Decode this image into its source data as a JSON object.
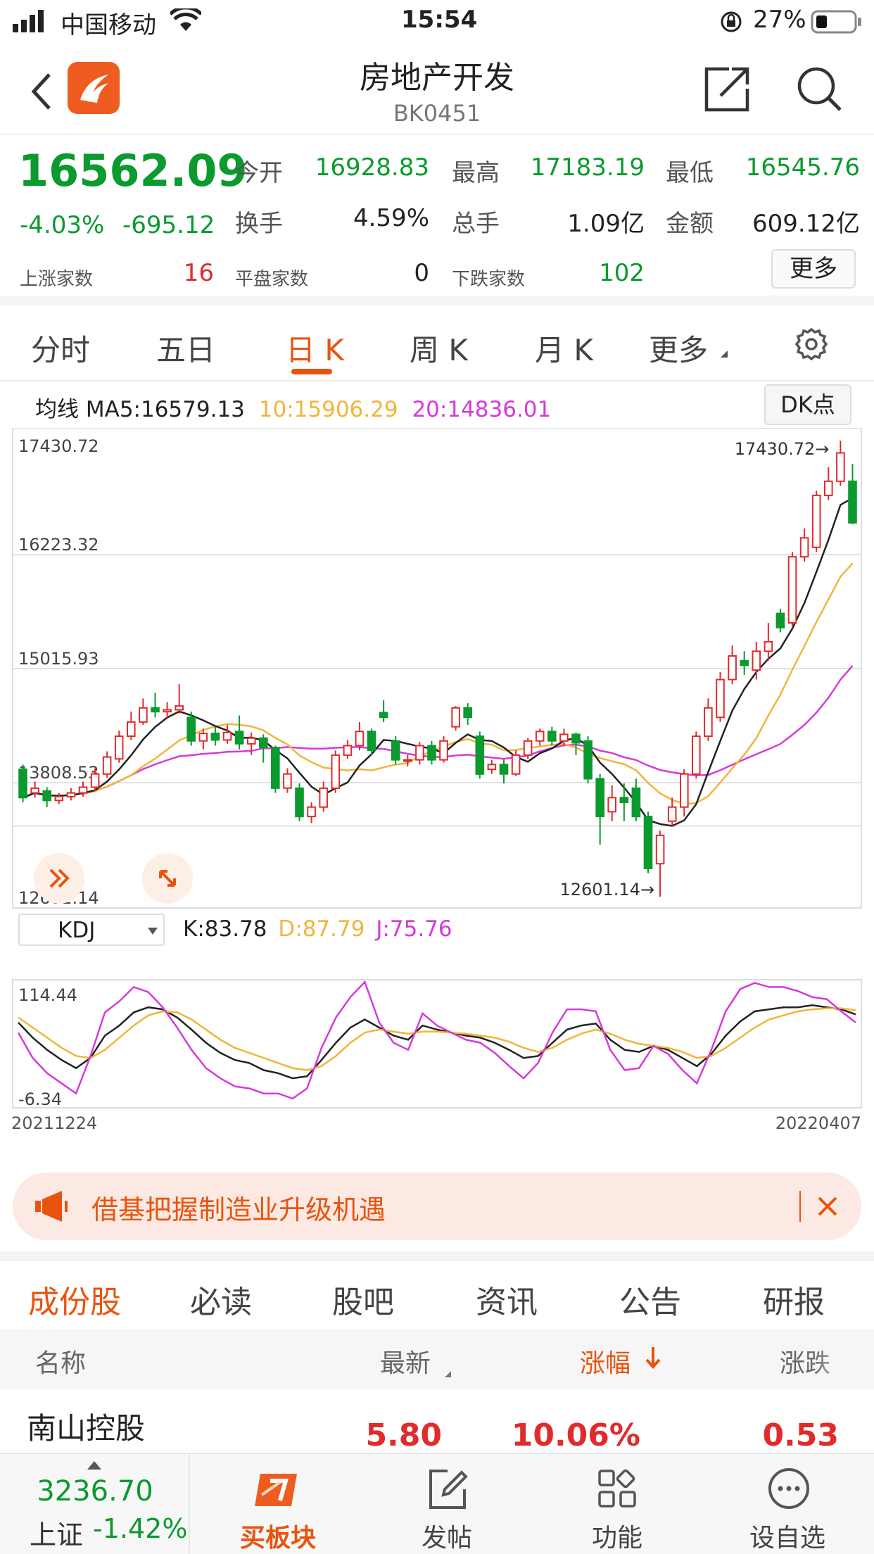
{
  "status": {
    "carrier": "中国移动",
    "time": "15:54",
    "battery": "27%"
  },
  "nav": {
    "title": "房地产开发",
    "code": "BK0451"
  },
  "quote": {
    "price": "16562.09",
    "change_pct": "-4.03%",
    "change": "-695.12",
    "open_label": "今开",
    "open": "16928.83",
    "high_label": "最高",
    "high": "17183.19",
    "low_label": "最低",
    "low": "16545.76",
    "turnover_label": "换手",
    "turnover": "4.59%",
    "volume_label": "总手",
    "volume": "1.09亿",
    "amount_label": "金额",
    "amount": "609.12亿",
    "up_label": "上涨家数",
    "up": "16",
    "flat_label": "平盘家数",
    "flat": "0",
    "down_label": "下跌家数",
    "down": "102",
    "more": "更多"
  },
  "tabs": [
    "分时",
    "五日",
    "日 K",
    "周 K",
    "月 K",
    "更多"
  ],
  "active_tab": "日 K",
  "ma": {
    "label": "均线",
    "ma5": "MA5:16579.13",
    "ma10": "10:15906.29",
    "ma20": "20:14836.01",
    "dk": "DK点"
  },
  "kdj": {
    "label": "KDJ",
    "k": "K:83.78",
    "d": "D:87.79",
    "j": "J:75.76"
  },
  "colors": {
    "up": "#e02b2b",
    "down": "#0a9a2e",
    "ma10": "#f2b53a",
    "ma20": "#d63ad8",
    "accent": "#e8540f"
  },
  "chart_data": [
    {
      "type": "candlestick",
      "ylim": [
        12601.14,
        17430.72
      ],
      "y_ticks": [
        "17430.72",
        "16223.32",
        "15015.93",
        "13808.53",
        "12601.14"
      ],
      "x_range": [
        "20211224",
        "20220407"
      ],
      "annotations": {
        "max": "17430.72",
        "min": "12601.14"
      },
      "candles": [
        {
          "o": 13950,
          "c": 13650,
          "h": 14000,
          "l": 13600
        },
        {
          "o": 13700,
          "c": 13750,
          "h": 13820,
          "l": 13650
        },
        {
          "o": 13720,
          "c": 13620,
          "h": 13760,
          "l": 13550
        },
        {
          "o": 13620,
          "c": 13660,
          "h": 13700,
          "l": 13580
        },
        {
          "o": 13660,
          "c": 13700,
          "h": 13750,
          "l": 13620
        },
        {
          "o": 13700,
          "c": 13760,
          "h": 13820,
          "l": 13660
        },
        {
          "o": 13760,
          "c": 13900,
          "h": 13960,
          "l": 13720
        },
        {
          "o": 13900,
          "c": 14080,
          "h": 14140,
          "l": 13860
        },
        {
          "o": 14060,
          "c": 14300,
          "h": 14360,
          "l": 14020
        },
        {
          "o": 14300,
          "c": 14450,
          "h": 14560,
          "l": 14260
        },
        {
          "o": 14450,
          "c": 14600,
          "h": 14700,
          "l": 14420
        },
        {
          "o": 14600,
          "c": 14560,
          "h": 14760,
          "l": 14500
        },
        {
          "o": 14560,
          "c": 14580,
          "h": 14660,
          "l": 14480
        },
        {
          "o": 14580,
          "c": 14620,
          "h": 14850,
          "l": 14540
        },
        {
          "o": 14500,
          "c": 14250,
          "h": 14560,
          "l": 14200
        },
        {
          "o": 14250,
          "c": 14330,
          "h": 14380,
          "l": 14160
        },
        {
          "o": 14330,
          "c": 14260,
          "h": 14400,
          "l": 14200
        },
        {
          "o": 14260,
          "c": 14340,
          "h": 14420,
          "l": 14220
        },
        {
          "o": 14350,
          "c": 14220,
          "h": 14520,
          "l": 14160
        },
        {
          "o": 14220,
          "c": 14280,
          "h": 14340,
          "l": 14100
        },
        {
          "o": 14280,
          "c": 14180,
          "h": 14320,
          "l": 14020
        },
        {
          "o": 14180,
          "c": 13750,
          "h": 14200,
          "l": 13700
        },
        {
          "o": 13750,
          "c": 13900,
          "h": 13960,
          "l": 13700
        },
        {
          "o": 13750,
          "c": 13450,
          "h": 13800,
          "l": 13400
        },
        {
          "o": 13450,
          "c": 13550,
          "h": 13600,
          "l": 13380
        },
        {
          "o": 13550,
          "c": 13750,
          "h": 13820,
          "l": 13500
        },
        {
          "o": 13750,
          "c": 14100,
          "h": 14150,
          "l": 13700
        },
        {
          "o": 14100,
          "c": 14200,
          "h": 14260,
          "l": 14060
        },
        {
          "o": 14200,
          "c": 14350,
          "h": 14450,
          "l": 14150
        },
        {
          "o": 14350,
          "c": 14150,
          "h": 14380,
          "l": 14100
        },
        {
          "o": 14550,
          "c": 14500,
          "h": 14680,
          "l": 14450
        },
        {
          "o": 14250,
          "c": 14050,
          "h": 14300,
          "l": 14000
        },
        {
          "o": 14050,
          "c": 14050,
          "h": 14100,
          "l": 13980
        },
        {
          "o": 14050,
          "c": 14200,
          "h": 14240,
          "l": 14000
        },
        {
          "o": 14200,
          "c": 14050,
          "h": 14250,
          "l": 14000
        },
        {
          "o": 14050,
          "c": 14250,
          "h": 14300,
          "l": 14020
        },
        {
          "o": 14400,
          "c": 14600,
          "h": 14620,
          "l": 14360
        },
        {
          "o": 14600,
          "c": 14500,
          "h": 14650,
          "l": 14420
        },
        {
          "o": 14300,
          "c": 13900,
          "h": 14350,
          "l": 13850
        },
        {
          "o": 13950,
          "c": 14000,
          "h": 14050,
          "l": 13900
        },
        {
          "o": 14000,
          "c": 13900,
          "h": 14050,
          "l": 13800
        },
        {
          "o": 13900,
          "c": 14100,
          "h": 14150,
          "l": 13880
        },
        {
          "o": 14100,
          "c": 14250,
          "h": 14280,
          "l": 14060
        },
        {
          "o": 14250,
          "c": 14350,
          "h": 14380,
          "l": 14200
        },
        {
          "o": 14350,
          "c": 14250,
          "h": 14400,
          "l": 14200
        },
        {
          "o": 14250,
          "c": 14320,
          "h": 14380,
          "l": 14200
        },
        {
          "o": 14320,
          "c": 14230,
          "h": 14340,
          "l": 14100
        },
        {
          "o": 14250,
          "c": 13850,
          "h": 14300,
          "l": 13800
        },
        {
          "o": 13850,
          "c": 13450,
          "h": 13900,
          "l": 13150
        },
        {
          "o": 13500,
          "c": 13650,
          "h": 13780,
          "l": 13400
        },
        {
          "o": 13650,
          "c": 13600,
          "h": 13800,
          "l": 13400
        },
        {
          "o": 13750,
          "c": 13450,
          "h": 13850,
          "l": 13400
        },
        {
          "o": 13450,
          "c": 12900,
          "h": 13500,
          "l": 12850
        },
        {
          "o": 12950,
          "c": 13250,
          "h": 13300,
          "l": 12601
        },
        {
          "o": 13400,
          "c": 13550,
          "h": 13650,
          "l": 13350
        },
        {
          "o": 13550,
          "c": 13900,
          "h": 13950,
          "l": 13450
        },
        {
          "o": 13900,
          "c": 14300,
          "h": 14350,
          "l": 13850
        },
        {
          "o": 14300,
          "c": 14600,
          "h": 14700,
          "l": 14250
        },
        {
          "o": 14500,
          "c": 14900,
          "h": 14980,
          "l": 14450
        },
        {
          "o": 14900,
          "c": 15150,
          "h": 15260,
          "l": 14850
        },
        {
          "o": 15100,
          "c": 15050,
          "h": 15200,
          "l": 14950
        },
        {
          "o": 15000,
          "c": 15200,
          "h": 15300,
          "l": 14900
        },
        {
          "o": 15200,
          "c": 15300,
          "h": 15500,
          "l": 15100
        },
        {
          "o": 15600,
          "c": 15450,
          "h": 15650,
          "l": 15400
        },
        {
          "o": 15500,
          "c": 16200,
          "h": 16250,
          "l": 15450
        },
        {
          "o": 16200,
          "c": 16400,
          "h": 16500,
          "l": 16150
        },
        {
          "o": 16300,
          "c": 16850,
          "h": 16900,
          "l": 16250
        },
        {
          "o": 16850,
          "c": 17000,
          "h": 17150,
          "l": 16800
        },
        {
          "o": 17000,
          "c": 17300,
          "h": 17430,
          "l": 16950
        },
        {
          "o": 17000,
          "c": 16560,
          "h": 17183,
          "l": 16545
        }
      ]
    },
    {
      "type": "line",
      "title": "KDJ",
      "ylim": [
        -6.34,
        114.44
      ],
      "y_ticks": [
        "114.44",
        "-6.34"
      ],
      "x_range": [
        "20211224",
        "20220407"
      ],
      "series": [
        {
          "name": "K",
          "values": [
            75,
            60,
            48,
            38,
            30,
            40,
            62,
            72,
            85,
            90,
            88,
            80,
            68,
            55,
            45,
            38,
            35,
            28,
            25,
            20,
            22,
            38,
            55,
            70,
            78,
            70,
            62,
            58,
            72,
            68,
            65,
            62,
            60,
            55,
            48,
            40,
            42,
            55,
            68,
            72,
            74,
            58,
            48,
            46,
            52,
            48,
            40,
            32,
            44,
            62,
            76,
            86,
            88,
            90,
            90,
            92,
            90,
            88,
            83
          ]
        },
        {
          "name": "D",
          "values": [
            80,
            70,
            60,
            50,
            42,
            40,
            48,
            60,
            72,
            82,
            86,
            85,
            78,
            68,
            58,
            50,
            45,
            40,
            35,
            30,
            28,
            32,
            42,
            55,
            65,
            68,
            66,
            64,
            66,
            66,
            65,
            64,
            62,
            60,
            56,
            50,
            46,
            50,
            58,
            64,
            68,
            64,
            58,
            54,
            52,
            50,
            46,
            40,
            42,
            50,
            60,
            70,
            78,
            82,
            86,
            88,
            89,
            89,
            87
          ]
        },
        {
          "name": "J",
          "values": [
            65,
            40,
            25,
            15,
            5,
            42,
            85,
            96,
            110,
            105,
            90,
            70,
            48,
            30,
            20,
            12,
            10,
            5,
            5,
            0,
            10,
            50,
            80,
            100,
            115,
            75,
            55,
            48,
            84,
            72,
            65,
            58,
            55,
            45,
            32,
            20,
            35,
            65,
            88,
            88,
            86,
            48,
            28,
            30,
            52,
            44,
            28,
            15,
            48,
            86,
            108,
            114,
            110,
            110,
            106,
            100,
            98,
            86,
            75
          ]
        }
      ]
    }
  ],
  "banner": {
    "text": "借基把握制造业升级机遇"
  },
  "subtabs": [
    "成份股",
    "必读",
    "股吧",
    "资讯",
    "公告",
    "研报"
  ],
  "table": {
    "headers": [
      "名称",
      "最新",
      "涨幅",
      "涨跌"
    ],
    "rows": [
      {
        "name": "南山控股",
        "last": "5.80",
        "pct": "10.06%",
        "chg": "0.53"
      }
    ]
  },
  "bottom": {
    "index_value": "3236.70",
    "index_name": "上证",
    "index_pct": "-1.42%",
    "buy": "买板块",
    "post": "发帖",
    "func": "功能",
    "watch": "设自选"
  }
}
